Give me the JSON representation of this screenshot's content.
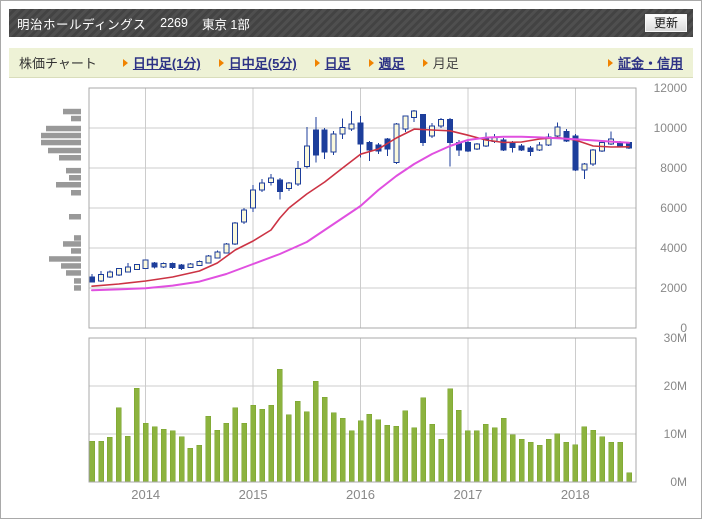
{
  "window": {
    "stock_name": "明治ホールディングス",
    "stock_code": "2269",
    "market": "東京 1部",
    "refresh_label": "更新"
  },
  "tabbar": {
    "label": "株価チャート",
    "tabs": [
      {
        "label": "日中足(1分)",
        "active": false
      },
      {
        "label": "日中足(5分)",
        "active": false
      },
      {
        "label": "日足",
        "active": false
      },
      {
        "label": "週足",
        "active": false
      },
      {
        "label": "月足",
        "active": true
      }
    ],
    "right_link": "証金・信用"
  },
  "colors": {
    "grid": "#cccccc",
    "axis": "#a9a9a9",
    "label": "#888888",
    "up": "#faf8dc",
    "down": "#1d3e9b",
    "ma_short": "#cc3344",
    "ma_long": "#e050e0",
    "vol": "#8cb33e",
    "vol_border": "#7aa32f",
    "profile": "#999999"
  },
  "chart_data": [
    {
      "type": "candlestick",
      "x_unit": "month",
      "ylim": [
        0,
        12000
      ],
      "y_ticks": [
        {
          "v": 12000,
          "t": "12000"
        },
        {
          "v": 10000,
          "t": "10000"
        },
        {
          "v": 8000,
          "t": "8000"
        },
        {
          "v": 6000,
          "t": "6000"
        },
        {
          "v": 4000,
          "t": "4000"
        },
        {
          "v": 2000,
          "t": "2000"
        },
        {
          "v": 0,
          "t": "0"
        }
      ],
      "x_year_ticks": [
        {
          "i": 6,
          "t": "2014"
        },
        {
          "i": 18,
          "t": "2015"
        },
        {
          "i": 30,
          "t": "2016"
        },
        {
          "i": 42,
          "t": "2017"
        },
        {
          "i": 54,
          "t": "2018"
        }
      ],
      "candles": [
        [
          2550,
          2700,
          2270,
          2310
        ],
        [
          2340,
          2840,
          2310,
          2670
        ],
        [
          2540,
          2870,
          2500,
          2800
        ],
        [
          2640,
          3000,
          2600,
          2970
        ],
        [
          2800,
          3260,
          2780,
          3040
        ],
        [
          2920,
          3200,
          2890,
          3170
        ],
        [
          2980,
          3420,
          2950,
          3390
        ],
        [
          3260,
          3300,
          2980,
          3050
        ],
        [
          3060,
          3280,
          3000,
          3230
        ],
        [
          3230,
          3270,
          2960,
          3030
        ],
        [
          3160,
          3200,
          2900,
          2980
        ],
        [
          3020,
          3240,
          2990,
          3190
        ],
        [
          3130,
          3380,
          3100,
          3330
        ],
        [
          3260,
          3650,
          3230,
          3590
        ],
        [
          3500,
          3870,
          3470,
          3800
        ],
        [
          3760,
          4250,
          3720,
          4200
        ],
        [
          4200,
          5300,
          4150,
          5250
        ],
        [
          5300,
          6000,
          5200,
          5900
        ],
        [
          6000,
          7150,
          5800,
          6900
        ],
        [
          6900,
          7440,
          6800,
          7240
        ],
        [
          7270,
          7690,
          7130,
          7490
        ],
        [
          7400,
          7500,
          6430,
          6820
        ],
        [
          6970,
          7300,
          6850,
          7240
        ],
        [
          7190,
          8350,
          7100,
          7970
        ],
        [
          8070,
          10060,
          7970,
          9110
        ],
        [
          9900,
          10560,
          8270,
          8650
        ],
        [
          9890,
          10000,
          8440,
          8810
        ],
        [
          8810,
          9860,
          8650,
          9690
        ],
        [
          9690,
          10480,
          9440,
          10030
        ],
        [
          9950,
          10860,
          9850,
          10200
        ],
        [
          10250,
          10610,
          8520,
          9190
        ],
        [
          9275,
          9350,
          8360,
          8910
        ],
        [
          9145,
          9250,
          8700,
          8860
        ],
        [
          9440,
          9500,
          8610,
          8940
        ],
        [
          8270,
          10250,
          8200,
          10200
        ],
        [
          9950,
          10610,
          9800,
          10610
        ],
        [
          10530,
          10900,
          10300,
          10860
        ],
        [
          10670,
          10700,
          9100,
          9270
        ],
        [
          9610,
          10250,
          9500,
          10110
        ],
        [
          10110,
          10500,
          10000,
          10420
        ],
        [
          10420,
          10500,
          8070,
          9270
        ],
        [
          9270,
          9400,
          8610,
          8910
        ],
        [
          9280,
          9350,
          8800,
          8860
        ],
        [
          8940,
          9250,
          8900,
          9190
        ],
        [
          9110,
          9780,
          9050,
          9440
        ],
        [
          9330,
          9700,
          9250,
          9560
        ],
        [
          9390,
          9500,
          8850,
          8890
        ],
        [
          9280,
          9350,
          8780,
          9030
        ],
        [
          9110,
          9200,
          8850,
          8890
        ],
        [
          8990,
          9100,
          8610,
          8830
        ],
        [
          8910,
          9300,
          8850,
          9160
        ],
        [
          9140,
          9720,
          9100,
          9560
        ],
        [
          9610,
          10280,
          9550,
          10060
        ],
        [
          9830,
          9950,
          9300,
          9360
        ],
        [
          9610,
          9700,
          7850,
          7890
        ],
        [
          7890,
          8250,
          7440,
          8190
        ],
        [
          8200,
          8950,
          8100,
          8890
        ],
        [
          8860,
          9350,
          8800,
          9280
        ],
        [
          9190,
          9830,
          9150,
          9440
        ],
        [
          9280,
          9350,
          9050,
          9110
        ],
        [
          9280,
          9300,
          8950,
          9000
        ]
      ],
      "ma_short": [
        [
          0,
          2090
        ],
        [
          3,
          2200
        ],
        [
          6,
          2350
        ],
        [
          9,
          2550
        ],
        [
          12,
          2850
        ],
        [
          14,
          3250
        ],
        [
          16,
          3900
        ],
        [
          18,
          4350
        ],
        [
          20,
          4900
        ],
        [
          21,
          5500
        ],
        [
          22,
          6000
        ],
        [
          24,
          6700
        ],
        [
          26,
          7300
        ],
        [
          28,
          8000
        ],
        [
          30,
          8690
        ],
        [
          32,
          8950
        ],
        [
          34,
          9500
        ],
        [
          36,
          9945
        ],
        [
          38,
          9900
        ],
        [
          40,
          9860
        ],
        [
          42,
          9640
        ],
        [
          44,
          9400
        ],
        [
          46,
          9275
        ],
        [
          48,
          9300
        ],
        [
          50,
          9450
        ],
        [
          52,
          9520
        ],
        [
          54,
          9400
        ],
        [
          56,
          9100
        ],
        [
          58,
          9050
        ],
        [
          60,
          9060
        ]
      ],
      "ma_long": [
        [
          0,
          1890
        ],
        [
          3,
          1930
        ],
        [
          6,
          1990
        ],
        [
          9,
          2120
        ],
        [
          12,
          2320
        ],
        [
          15,
          2700
        ],
        [
          18,
          3200
        ],
        [
          21,
          3700
        ],
        [
          24,
          4300
        ],
        [
          26,
          4900
        ],
        [
          28,
          5500
        ],
        [
          30,
          6100
        ],
        [
          32,
          6900
        ],
        [
          34,
          7600
        ],
        [
          36,
          8200
        ],
        [
          38,
          8700
        ],
        [
          40,
          9100
        ],
        [
          42,
          9400
        ],
        [
          44,
          9520
        ],
        [
          46,
          9560
        ],
        [
          48,
          9560
        ],
        [
          50,
          9530
        ],
        [
          52,
          9490
        ],
        [
          54,
          9440
        ],
        [
          56,
          9380
        ],
        [
          58,
          9320
        ],
        [
          60,
          9260
        ]
      ],
      "volume_profile": [
        {
          "price": 10810,
          "len": 18
        },
        {
          "price": 10460,
          "len": 10
        },
        {
          "price": 9960,
          "len": 35
        },
        {
          "price": 9610,
          "len": 40
        },
        {
          "price": 9260,
          "len": 40
        },
        {
          "price": 8860,
          "len": 33
        },
        {
          "price": 8500,
          "len": 22
        },
        {
          "price": 7855,
          "len": 15
        },
        {
          "price": 7500,
          "len": 12
        },
        {
          "price": 7150,
          "len": 25
        },
        {
          "price": 6750,
          "len": 10
        },
        {
          "price": 5550,
          "len": 12
        },
        {
          "price": 4490,
          "len": 7
        },
        {
          "price": 4190,
          "len": 18
        },
        {
          "price": 3840,
          "len": 10
        },
        {
          "price": 3440,
          "len": 32
        },
        {
          "price": 3090,
          "len": 20
        },
        {
          "price": 2740,
          "len": 15
        },
        {
          "price": 2340,
          "len": 7
        },
        {
          "price": 1990,
          "len": 7
        }
      ]
    },
    {
      "type": "bar",
      "x_unit": "month",
      "ylim": [
        0,
        30
      ],
      "y_ticks": [
        {
          "v": 30,
          "t": "30M"
        },
        {
          "v": 20,
          "t": "20M"
        },
        {
          "v": 10,
          "t": "10M"
        },
        {
          "v": 0,
          "t": "0M"
        }
      ],
      "values": [
        8.5,
        8.5,
        9.3,
        15.5,
        9.5,
        19.5,
        12.2,
        11.5,
        11.0,
        10.7,
        9.4,
        7.0,
        7.7,
        13.7,
        10.8,
        12.2,
        15.5,
        12.2,
        16.0,
        15.2,
        16.0,
        23.5,
        14.0,
        16.8,
        14.6,
        21.0,
        17.7,
        14.4,
        13.3,
        10.7,
        12.8,
        14.1,
        13.0,
        11.8,
        11.6,
        14.9,
        11.3,
        17.6,
        12.0,
        8.9,
        19.4,
        15.0,
        10.7,
        10.7,
        12.0,
        11.3,
        13.3,
        9.9,
        8.9,
        8.3,
        7.7,
        8.9,
        10.1,
        8.3,
        7.8,
        11.5,
        10.8,
        9.4,
        8.3,
        8.3,
        1.9
      ]
    }
  ]
}
